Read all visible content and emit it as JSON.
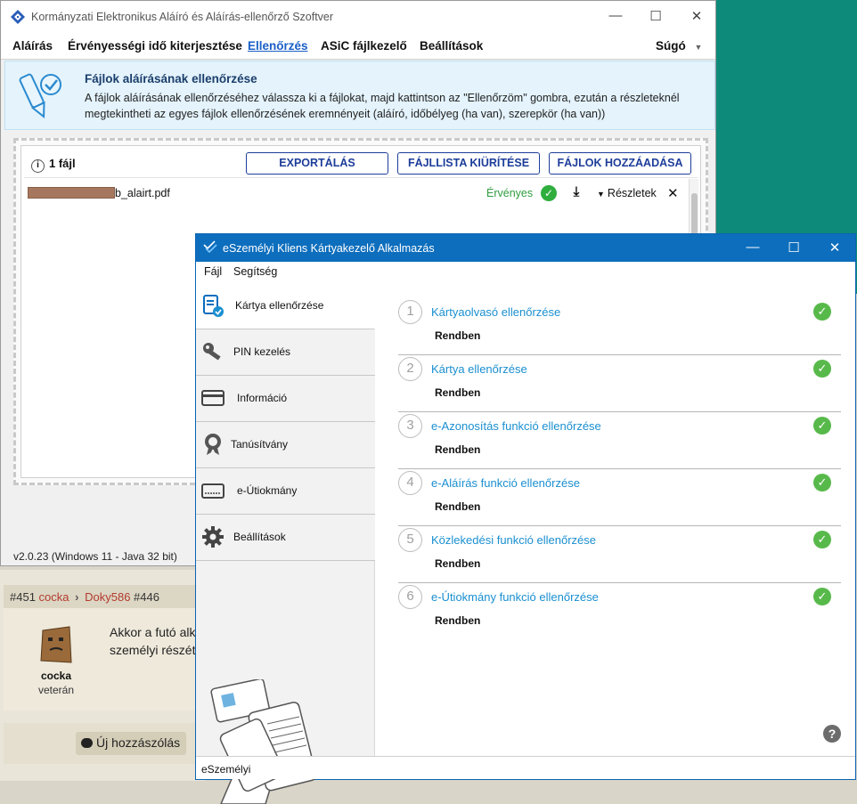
{
  "colors": {
    "accent": "#1a5fc6",
    "title_bar": "#0d6ebd",
    "ok_green": "#58b94b",
    "valid_green": "#2f9d3f"
  },
  "signer": {
    "title": "Kormányzati Elektronikus Aláíró és Aláírás-ellenőrző Szoftver",
    "menu": [
      "Aláírás",
      "Érvényességi idő kiterjesztése",
      "Ellenőrzés",
      "ASiC fájlkezelő",
      "Beállítások"
    ],
    "help_menu": "Súgó",
    "info_title": "Fájlok aláírásának ellenőrzése",
    "info_text": "A fájlok aláírásának ellenőrzéséhez válassza ki a fájlokat, majd kattintson az \"Ellenőrzöm\" gombra, ezután a részleteknél megtekintheti az egyes fájlok ellenőrzésének eremnényeit (aláíró, időbélyeg (ha van), szerepkör (ha van))",
    "file_count": "1 fájl",
    "buttons": {
      "export": "EXPORTÁLÁS",
      "clear": "FÁJLLISTA KIÜRÍTÉSE",
      "add": "FÁJLOK HOZZÁADÁSA"
    },
    "file": {
      "name_suffix": "b_alairt.pdf",
      "status": "Érvényes",
      "details": "Részletek"
    },
    "version": "v2.0.23 (Windows 11 - Java 32 bit)",
    "icons": [
      "minimize-icon",
      "maximize-icon",
      "close-icon",
      "info-icon",
      "check-icon",
      "download-icon",
      "chevron-down-icon"
    ]
  },
  "forum": {
    "post_num": "#451",
    "author": "cocka",
    "reply_to": "Doky586",
    "reply_num": "#446",
    "poster_name": "cocka",
    "poster_rank": "veterán",
    "post_lines": [
      "Akkor a futó alk",
      "személyi részét"
    ],
    "new_post": "Új hozzászólás"
  },
  "eszemelyi": {
    "title": "eSzemélyi Kliens Kártyakezelő Alkalmazás",
    "menu": [
      "Fájl",
      "Segítség"
    ],
    "sidebar": [
      "Kártya ellenőrzése",
      "PIN kezelés",
      "Információ",
      "Tanúsítvány",
      "e-Útiokmány",
      "Beállítások"
    ],
    "checks": [
      {
        "num": "1",
        "title": "Kártyaolvasó ellenőrzése",
        "status": "Rendben"
      },
      {
        "num": "2",
        "title": "Kártya ellenőrzése",
        "status": "Rendben"
      },
      {
        "num": "3",
        "title": "e-Azonosítás funkció ellenőrzése",
        "status": "Rendben"
      },
      {
        "num": "4",
        "title": "e-Aláírás funkció ellenőrzése",
        "status": "Rendben"
      },
      {
        "num": "5",
        "title": "Közlekedési funkció ellenőrzése",
        "status": "Rendben"
      },
      {
        "num": "6",
        "title": "e-Útiokmány funkció ellenőrzése",
        "status": "Rendben"
      }
    ],
    "status_bar": "eSzemélyi",
    "help": "?"
  }
}
